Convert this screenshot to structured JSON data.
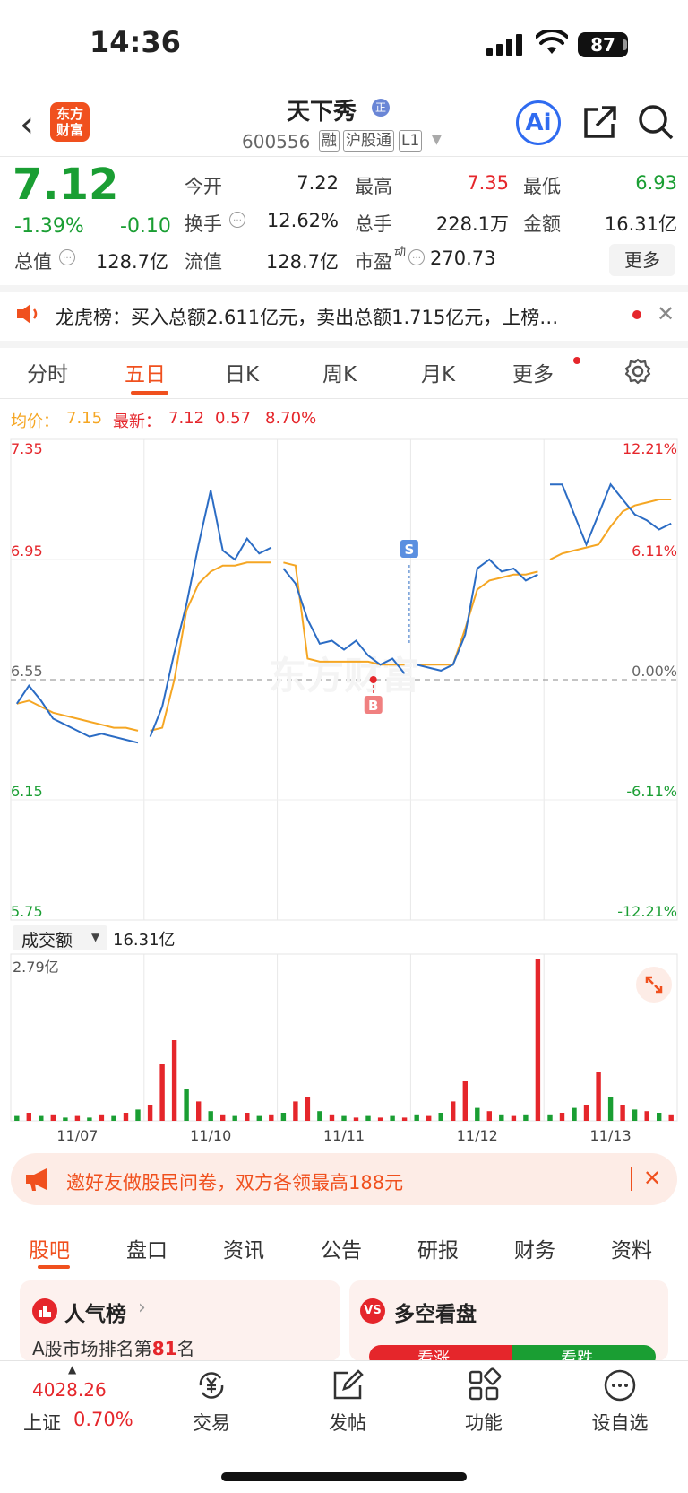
{
  "status_bar": {
    "time": "14:36",
    "battery": "87"
  },
  "header": {
    "logo_text": "东方财富",
    "stock_name": "天下秀",
    "badge": "正",
    "code": "600556",
    "tags": [
      "融",
      "沪股通",
      "L1"
    ]
  },
  "quote": {
    "price": "7.12",
    "change_pct": "-1.39%",
    "change": "-0.10",
    "rows": [
      [
        {
          "label": "今开",
          "value": "7.22"
        },
        {
          "label": "最高",
          "value": "7.35"
        },
        {
          "label": "最低",
          "value": "6.93"
        }
      ],
      [
        {
          "label": "换手",
          "value": "12.62%"
        },
        {
          "label": "总手",
          "value": "228.1万"
        },
        {
          "label": "金额",
          "value": "16.31亿"
        }
      ],
      [
        {
          "label": "总值",
          "value": "128.7亿"
        },
        {
          "label": "流值",
          "value": "128.7亿"
        },
        {
          "label": "市盈",
          "sup": "动",
          "value": "270.73"
        }
      ]
    ],
    "more_btn": "更多"
  },
  "notice": {
    "text": "龙虎榜：买入总额2.611亿元，卖出总额1.715亿元，上榜…"
  },
  "chart_tabs": [
    "分时",
    "五日",
    "日K",
    "周K",
    "月K",
    "更多"
  ],
  "legend": {
    "avg_label": "均价：",
    "avg_value": "7.15",
    "latest_label": "最新：",
    "latest_value": "7.12",
    "chg": "0.57",
    "pct": "8.70%"
  },
  "colors": {
    "accent": "#f0501e",
    "up": "#e5262b",
    "down": "#1a9e33",
    "price_line": "#2b6cc4",
    "avg_line": "#f5a623"
  },
  "chart_data": {
    "type": "line",
    "title": "",
    "x_labels": [
      "11/07",
      "11/10",
      "11/11",
      "11/12",
      "11/13"
    ],
    "y_left": [
      "7.35",
      "6.95",
      "6.55",
      "6.15",
      "5.75"
    ],
    "y_right": [
      "12.21%",
      "6.11%",
      "0.00%",
      "-6.11%",
      "-12.21%"
    ],
    "ylim": [
      5.75,
      7.35
    ],
    "base_price": 6.55,
    "series": [
      {
        "name": "最新",
        "values": [
          6.47,
          6.53,
          6.48,
          6.42,
          6.4,
          6.38,
          6.36,
          6.37,
          6.36,
          6.35,
          6.34,
          6.36,
          6.46,
          6.64,
          6.8,
          7.0,
          7.18,
          6.98,
          6.95,
          7.02,
          6.97,
          6.99,
          6.92,
          6.87,
          6.75,
          6.67,
          6.68,
          6.65,
          6.68,
          6.63,
          6.6,
          6.62,
          6.57,
          6.6,
          6.59,
          6.58,
          6.6,
          6.7,
          6.92,
          6.95,
          6.91,
          6.92,
          6.88,
          6.9,
          7.2,
          7.2,
          7.1,
          7.0,
          7.1,
          7.2,
          7.15,
          7.1,
          7.08,
          7.05,
          7.07
        ]
      },
      {
        "name": "均价",
        "values": [
          6.47,
          6.48,
          6.46,
          6.44,
          6.43,
          6.42,
          6.41,
          6.4,
          6.39,
          6.39,
          6.38,
          6.38,
          6.39,
          6.55,
          6.78,
          6.87,
          6.91,
          6.93,
          6.93,
          6.94,
          6.94,
          6.94,
          6.94,
          6.93,
          6.62,
          6.61,
          6.61,
          6.61,
          6.61,
          6.61,
          6.6,
          6.6,
          6.6,
          6.6,
          6.6,
          6.6,
          6.6,
          6.72,
          6.85,
          6.88,
          6.89,
          6.9,
          6.9,
          6.91,
          6.95,
          6.97,
          6.98,
          6.99,
          7.0,
          7.06,
          7.11,
          7.13,
          7.14,
          7.15,
          7.15
        ]
      }
    ],
    "markers": [
      {
        "label": "B",
        "type": "buy",
        "price": 6.55
      },
      {
        "label": "S",
        "type": "sell",
        "price": 6.88
      }
    ]
  },
  "volume": {
    "selector": "成交额",
    "total": "16.31亿",
    "max_label": "2.79亿",
    "bars": [
      0.03,
      0.05,
      0.03,
      0.04,
      0.02,
      0.03,
      0.02,
      0.04,
      0.03,
      0.05,
      0.07,
      0.1,
      0.35,
      0.5,
      0.2,
      0.12,
      0.06,
      0.04,
      0.03,
      0.05,
      0.03,
      0.04,
      0.05,
      0.12,
      0.15,
      0.06,
      0.04,
      0.03,
      0.02,
      0.03,
      0.02,
      0.03,
      0.02,
      0.04,
      0.03,
      0.05,
      0.12,
      0.25,
      0.08,
      0.06,
      0.04,
      0.03,
      0.04,
      1.0,
      0.04,
      0.05,
      0.08,
      0.1,
      0.3,
      0.15,
      0.1,
      0.07,
      0.06,
      0.05,
      0.04
    ]
  },
  "promo": {
    "text": "邀好友做股民问卷，双方各领最高188元"
  },
  "bottom_tabs": [
    "股吧",
    "盘口",
    "资讯",
    "公告",
    "研报",
    "财务",
    "资料"
  ],
  "cards": {
    "left_title": "人气榜",
    "rank_prefix": "A股市场排名第",
    "rank": "81",
    "rank_suffix": "名",
    "right_title": "多空看盘",
    "bull": "看涨",
    "bear": "看跌"
  },
  "bottom_bar": {
    "index_value": "4028.26",
    "index_name": "上证",
    "index_pct": "0.70%",
    "items": [
      "交易",
      "发帖",
      "功能",
      "设自选"
    ]
  }
}
